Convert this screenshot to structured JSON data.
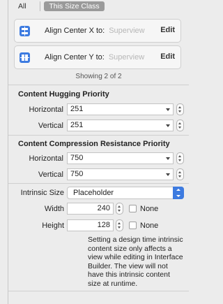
{
  "filter": {
    "all_label": "All",
    "size_class_label": "This Size Class"
  },
  "constraints": [
    {
      "label": "Align Center X to:",
      "target": "Superview",
      "edit": "Edit"
    },
    {
      "label": "Align Center Y to:",
      "target": "Superview",
      "edit": "Edit"
    }
  ],
  "showing": "Showing 2 of 2",
  "hugging": {
    "title": "Content Hugging Priority",
    "horizontal_label": "Horizontal",
    "horizontal_value": "251",
    "vertical_label": "Vertical",
    "vertical_value": "251"
  },
  "compression": {
    "title": "Content Compression Resistance Priority",
    "horizontal_label": "Horizontal",
    "horizontal_value": "750",
    "vertical_label": "Vertical",
    "vertical_value": "750"
  },
  "intrinsic": {
    "label": "Intrinsic Size",
    "value": "Placeholder",
    "width_label": "Width",
    "width_value": "240",
    "width_none": "None",
    "height_label": "Height",
    "height_value": "128",
    "height_none": "None",
    "note": "Setting a design time intrinsic content size only affects a view while editing in Interface Builder. The view will not have this intrinsic content size at runtime."
  },
  "colors": {
    "accent": "#3d7be0",
    "segment_selected": "#9a9a9a"
  }
}
